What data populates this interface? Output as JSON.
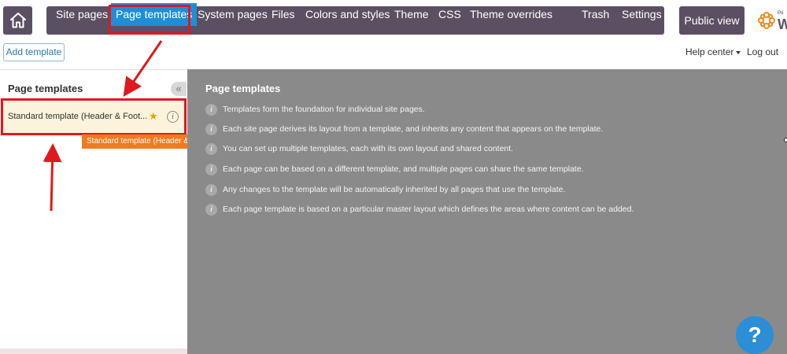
{
  "nav": {
    "items": [
      {
        "label": "Site pages"
      },
      {
        "label": "Page templates"
      },
      {
        "label": "System pages"
      },
      {
        "label": "Files"
      },
      {
        "label": "Colors and styles"
      },
      {
        "label": "Theme"
      },
      {
        "label": "CSS"
      },
      {
        "label": "Theme overrides"
      },
      {
        "label": "Trash"
      },
      {
        "label": "Settings"
      }
    ],
    "public_view": "Public view",
    "brand_small": "Po",
    "brand_big": "W"
  },
  "toolbar": {
    "add_template": "Add template",
    "help_center": "Help center",
    "logout": "Log out"
  },
  "left_panel": {
    "title": "Page templates",
    "collapse_glyph": "«",
    "template_item": "Standard template (Header & Foot...",
    "tooltip": "Standard template (Header & Footer)",
    "info_glyph": "i"
  },
  "main": {
    "title": "Page templates",
    "info_glyph": "i",
    "lines": [
      "Templates form the foundation for individual site pages.",
      "Each site page derives its layout from a template, and inherits any content that appears on the template.",
      "You can set up multiple templates, each with its own layout and shared content.",
      "Each page can be based on a different template, and multiple pages can share the same template.",
      "Any changes to the template will be automatically inherited by all pages that use the template.",
      "Each page template is based on a particular master layout which defines the areas where content can be added."
    ]
  },
  "help_bubble": "?",
  "colors": {
    "nav_bg": "#5b5063",
    "active_tab": "#1e8fd6",
    "annotation_red": "#e0191e",
    "tooltip_orange": "#f07b1c",
    "content_gray": "#8a8a8a",
    "selected_item": "#fbf3dc",
    "help_blue": "#2b8ed6"
  },
  "icons": {
    "home": "home-icon",
    "star": "star-icon",
    "info": "info-icon",
    "collapse": "double-chevron-left-icon",
    "help": "question-mark-icon",
    "brand": "flower-logo-icon",
    "dropdown": "caret-down-icon"
  }
}
